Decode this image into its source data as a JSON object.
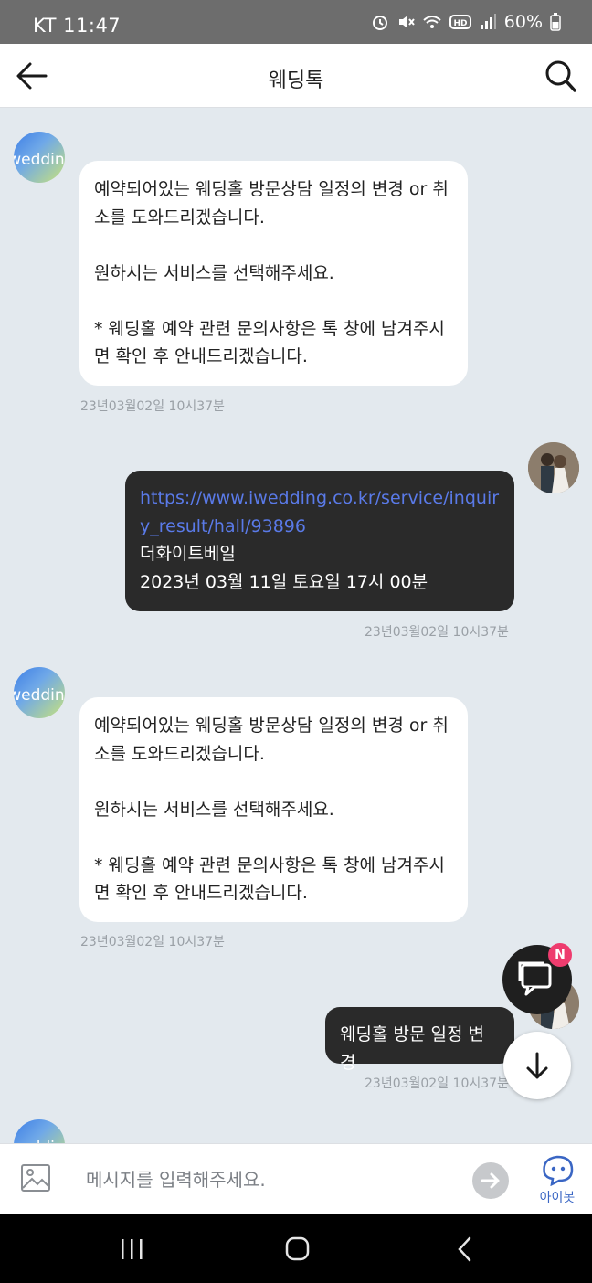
{
  "status_bar": {
    "carrier_time": "KT 11:47",
    "battery": "60%",
    "icons": [
      "alarm-icon",
      "mute-icon",
      "wifi-icon",
      "hd-icon",
      "signal-icon",
      "battery-icon"
    ]
  },
  "header": {
    "title": "웨딩톡",
    "back_icon": "back-arrow-icon",
    "search_icon": "search-icon"
  },
  "messages": [
    {
      "sender": "bot",
      "text": "예약되어있는 웨딩홀 방문상담 일정의 변경 or 취\n소를 도와드리겠습니다.\n\n원하시는 서비스를 선택해주세요.\n\n* 웨딩홀 예약 관련 문의사항은 톡 창에 남겨주시\n면 확인 후 안내드리겠습니다.",
      "timestamp": "23년03월02일 10시37분"
    },
    {
      "sender": "user",
      "link": "https://www.iwedding.co.kr/service/inquiry_result/hall/93896",
      "line1": "더화이트베일",
      "line2": "2023년 03월 11일 토요일 17시 00분",
      "timestamp": "23년03월02일 10시37분"
    },
    {
      "sender": "bot",
      "text": "예약되어있는 웨딩홀 방문상담 일정의 변경 or 취\n소를 도와드리겠습니다.\n\n원하시는 서비스를 선택해주세요.\n\n* 웨딩홀 예약 관련 문의사항은 톡 창에 남겨주시\n면 확인 후 안내드리겠습니다.",
      "timestamp": "23년03월02일 10시37분"
    },
    {
      "sender": "user",
      "text": "웨딩홀 방문 일정 변경",
      "timestamp": "23년03월02일 10시37분"
    }
  ],
  "bot_logo_text": "iwedding",
  "fab": {
    "chat_badge": "N"
  },
  "input": {
    "placeholder": "메시지를 입력해주세요.",
    "ibot_label": "아이봇"
  }
}
